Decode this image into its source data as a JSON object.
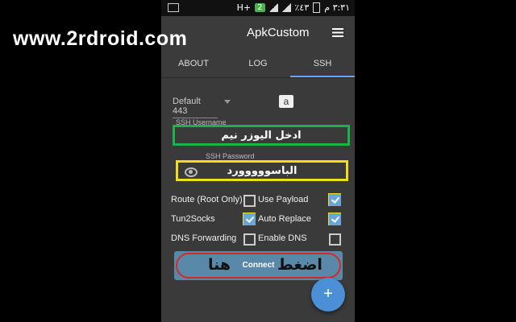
{
  "statusbar": {
    "network_label": "H+",
    "sim_badge": "2",
    "battery_text": "٪٤٣",
    "time": "٣:٣١ م"
  },
  "toolbar": {
    "title": "ApkCustom"
  },
  "tabs": [
    {
      "label": "ABOUT",
      "active": false
    },
    {
      "label": "LOG",
      "active": false
    },
    {
      "label": "SSH",
      "active": true
    }
  ],
  "ssh": {
    "port_value": "Default 443",
    "username_label": "SSH Username",
    "username_value": "ادخل اليوزر نيم",
    "password_label": "SSH Password",
    "password_value": "الباسووووورد",
    "options": [
      {
        "label": "Route (Root Only)",
        "checked": false
      },
      {
        "label": "Use Payload",
        "checked": true
      },
      {
        "label": "Tun2Socks",
        "checked": true
      },
      {
        "label": "Auto Replace",
        "checked": true
      },
      {
        "label": "DNS Forwarding",
        "checked": false
      },
      {
        "label": "Enable DNS",
        "checked": false
      }
    ],
    "connect_label": "Connect",
    "connect_annotation_1": "اضغط",
    "connect_annotation_2": "هنا",
    "fab_label": "+"
  },
  "watermark": "www.2rdroid.com",
  "colors": {
    "username_highlight": "#19b34a",
    "password_highlight": "#f2dd1a",
    "connect_highlight": "#d42a2a",
    "connect_button": "#5a88a8",
    "fab": "#4b8fd6"
  },
  "icons": [
    "image-icon",
    "signal-icon",
    "battery-icon",
    "menu-icon",
    "a-icon",
    "eye-icon",
    "plus-icon"
  ]
}
